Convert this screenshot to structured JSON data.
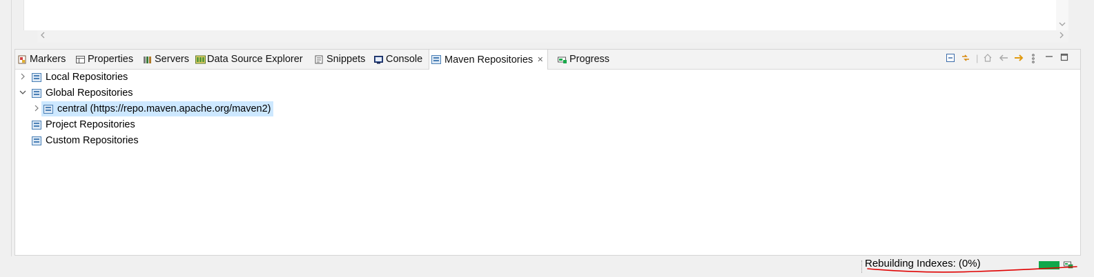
{
  "editor": {
    "scroll_left_glyph": "<",
    "scroll_right_glyph": ">",
    "scroll_down_glyph": "v"
  },
  "tabs": [
    {
      "label": "Markers",
      "icon": "markers-icon",
      "active": false
    },
    {
      "label": "Properties",
      "icon": "properties-icon",
      "active": false
    },
    {
      "label": "Servers",
      "icon": "servers-icon",
      "active": false
    },
    {
      "label": "Data Source Explorer",
      "icon": "data-source-explorer-icon",
      "active": false
    },
    {
      "label": "Snippets",
      "icon": "snippets-icon",
      "active": false
    },
    {
      "label": "Console",
      "icon": "console-icon",
      "active": false
    },
    {
      "label": "Maven Repositories",
      "icon": "maven-repositories-icon",
      "active": true,
      "close_glyph": "✕"
    },
    {
      "label": "Progress",
      "icon": "progress-icon",
      "active": false
    }
  ],
  "view_toolbar": {
    "collapse_all": "collapse-all-icon",
    "link_with_editor": "link-icon",
    "home": "home-icon",
    "back": "back-arrow-icon",
    "forward": "forward-arrow-icon",
    "menu": "view-menu-icon",
    "minimize": "minimize-icon",
    "maximize": "maximize-icon"
  },
  "tree": [
    {
      "label": "Local Repositories",
      "expanded": false,
      "level": 0,
      "icon": "repository-icon"
    },
    {
      "label": "Global Repositories",
      "expanded": true,
      "level": 0,
      "icon": "repository-icon"
    },
    {
      "label": "central (https://repo.maven.apache.org/maven2)",
      "expanded": false,
      "level": 1,
      "selected": true,
      "icon": "repository-icon"
    },
    {
      "label": "Project Repositories",
      "expanded": null,
      "level": 0,
      "icon": "repository-icon"
    },
    {
      "label": "Custom Repositories",
      "expanded": null,
      "level": 0,
      "icon": "repository-icon"
    }
  ],
  "status_bar": {
    "text": "Rebuilding Indexes: (0%)",
    "progress_fraction": 1.0,
    "progress_color": "#0fa84a",
    "annotation_color": "#e00000"
  },
  "colors": {
    "selection": "#cde8ff",
    "accent_blue": "#4a7fb5"
  }
}
